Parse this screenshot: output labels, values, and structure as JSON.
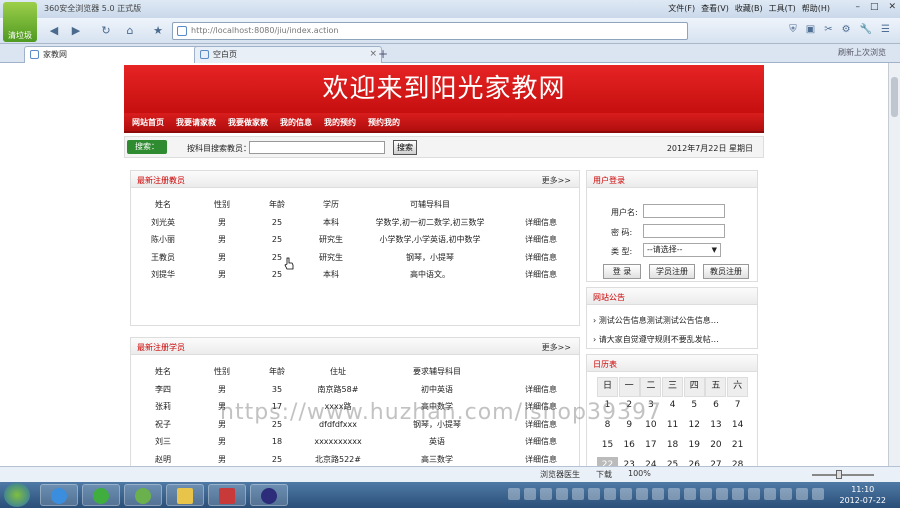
{
  "browser": {
    "app_label": "清垃圾",
    "title": "360安全浏览器 5.0 正式版",
    "menu": [
      "文件(F)",
      "查看(V)",
      "收藏(B)",
      "工具(T)",
      "帮助(H)"
    ],
    "url": "http://localhost:8080/jiu/index.action",
    "tabs": [
      {
        "label": "家教网",
        "active": true
      },
      {
        "label": "空白页",
        "active": false
      }
    ],
    "tabbar_right": [
      "刷新上次浏览"
    ]
  },
  "site": {
    "banner": "欢迎来到阳光家教网",
    "nav": [
      "网站首页",
      "我要请家教",
      "我要做家教",
      "我的信息",
      "我的预约",
      "预约我的"
    ],
    "search_tag": "搜索：",
    "search_label": "按科目搜索教员：",
    "search_value": "",
    "search_button": "搜索",
    "date": "2012年7月22日  星期日"
  },
  "teachers": {
    "title": "最新注册教员",
    "more": "更多>>",
    "columns": [
      "姓名",
      "性别",
      "年龄",
      "学历",
      "可辅导科目",
      ""
    ],
    "rows": [
      [
        "刘光英",
        "男",
        "25",
        "本科",
        "学数学,初一初二数学,初三数学",
        "详细信息"
      ],
      [
        "陈小丽",
        "男",
        "25",
        "研究生",
        "小学数学,小学英语,初中数学",
        "详细信息"
      ],
      [
        "王教员",
        "男",
        "25",
        "研究生",
        "钢琴，小提琴",
        "详细信息"
      ],
      [
        "刘提华",
        "男",
        "25",
        "本科",
        "高中语文。",
        "详细信息"
      ]
    ]
  },
  "students": {
    "title": "最新注册学员",
    "more": "更多>>",
    "columns": [
      "姓名",
      "性别",
      "年龄",
      "住址",
      "要求辅导科目",
      ""
    ],
    "rows": [
      [
        "李四",
        "男",
        "35",
        "南京路58#",
        "初中英语",
        "详细信息"
      ],
      [
        "张莉",
        "男",
        "17",
        "xxxx路",
        "高中数学",
        "详细信息"
      ],
      [
        "祝子",
        "男",
        "25",
        "dfdfdfxxx",
        "钢琴，小提琴",
        "详细信息"
      ],
      [
        "刘三",
        "男",
        "18",
        "xxxxxxxxxx",
        "英语",
        "详细信息"
      ],
      [
        "赵明",
        "男",
        "25",
        "北京路522#",
        "高三数学",
        "详细信息"
      ]
    ]
  },
  "login": {
    "title": "用户登录",
    "username_label": "用户名:",
    "password_label": "密  码:",
    "type_label": "类  型:",
    "type_value": "--请选择--",
    "login_button": "登 录",
    "student_register": "学员注册",
    "teacher_register": "教员注册"
  },
  "notices": {
    "title": "网站公告",
    "items": [
      "测试公告信息测试测试公告信息…",
      "请大家自觉遵守规则不要乱发帖…"
    ]
  },
  "calendar": {
    "title": "日历表",
    "weekdays": [
      "日",
      "一",
      "二",
      "三",
      "四",
      "五",
      "六"
    ],
    "weeks": [
      [
        "1",
        "2",
        "3",
        "4",
        "5",
        "6",
        "7"
      ],
      [
        "8",
        "9",
        "10",
        "11",
        "12",
        "13",
        "14"
      ],
      [
        "15",
        "16",
        "17",
        "18",
        "19",
        "20",
        "21"
      ],
      [
        "22",
        "23",
        "24",
        "25",
        "26",
        "27",
        "28"
      ]
    ],
    "today": "22"
  },
  "watermark": "https://www.huzhan.com/ishop39397",
  "status": {
    "items": [
      "浏览器医生",
      "下载",
      "100%"
    ],
    "zoom": "100%"
  },
  "clock": {
    "time": "11:10",
    "date": "2012-07-22"
  }
}
